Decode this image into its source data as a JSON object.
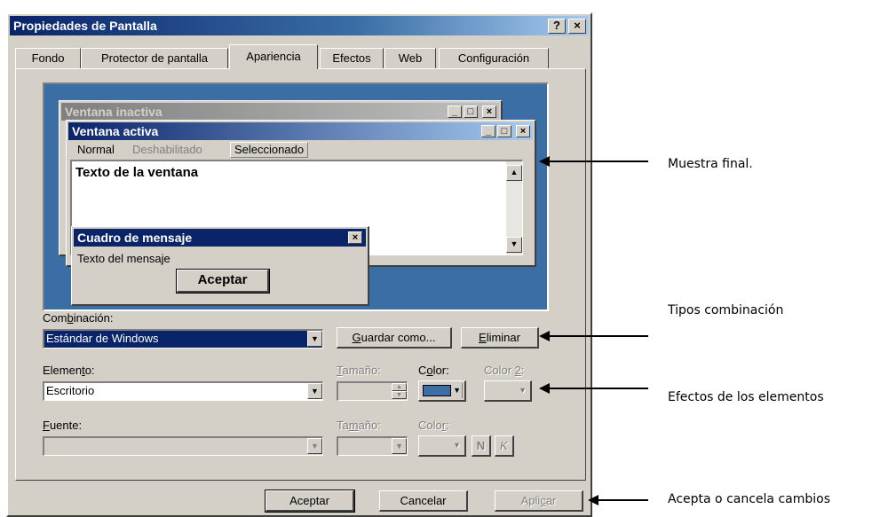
{
  "window": {
    "title": "Propiedades de Pantalla",
    "help_label": "?",
    "close_label": "×"
  },
  "tabs": [
    {
      "label": "Fondo"
    },
    {
      "label": "Protector de pantalla"
    },
    {
      "label": "Apariencia",
      "active": true
    },
    {
      "label": "Efectos"
    },
    {
      "label": "Web"
    },
    {
      "label": "Configuración"
    }
  ],
  "preview": {
    "inactive_title": "Ventana inactiva",
    "active_title": "Ventana activa",
    "menu": {
      "normal": "Normal",
      "disabled": "Deshabilitado",
      "selected": "Seleccionado"
    },
    "window_text": "Texto de la ventana",
    "message_title": "Cuadro de mensaje",
    "message_text": "Texto del mensaje",
    "ok_label": "Aceptar",
    "min_label": "_",
    "max_label": "□",
    "close_label": "×"
  },
  "scheme": {
    "label_pre": "Com",
    "label_u": "b",
    "label_post": "inación:",
    "value": "Estándar de Windows",
    "save_pre": "",
    "save_u": "G",
    "save_post": "uardar como...",
    "delete_pre": "",
    "delete_u": "E",
    "delete_post": "liminar"
  },
  "element": {
    "label_pre": "Elemen",
    "label_u": "t",
    "label_post": "o:",
    "value": "Escritorio",
    "size_label_pre": "",
    "size_label_u": "T",
    "size_label_post": "amaño:",
    "color_label_pre": "C",
    "color_label_u": "o",
    "color_label_post": "lor:",
    "color2_label_pre": "Color ",
    "color2_label_u": "2",
    "color2_label_post": ":",
    "color_swatch": "#3a6ea5"
  },
  "font": {
    "label_pre": "",
    "label_u": "F",
    "label_post": "uente:",
    "size_label_pre": "Ta",
    "size_label_u": "m",
    "size_label_post": "año:",
    "color_label_pre": "Colo",
    "color_label_u": "r",
    "color_label_post": ":",
    "bold_label": "N",
    "italic_label": "K"
  },
  "buttons": {
    "ok": "Aceptar",
    "cancel": "Cancelar",
    "apply_pre": "Apli",
    "apply_u": "c",
    "apply_post": "ar"
  },
  "annotations": {
    "preview": "Muestra final.",
    "schemes": "Tipos combinación",
    "effects": "Efectos de los elementos",
    "accept": "Acepta o cancela cambios"
  }
}
